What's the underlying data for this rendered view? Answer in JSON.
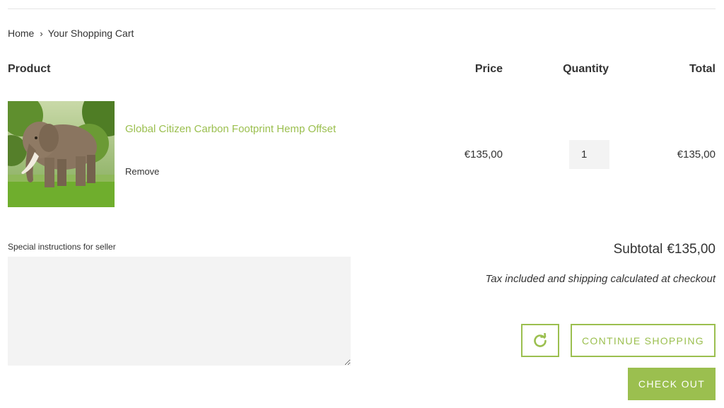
{
  "breadcrumb": {
    "home": "Home",
    "separator": "›",
    "current": "Your Shopping Cart"
  },
  "table_headers": {
    "product": "Product",
    "price": "Price",
    "quantity": "Quantity",
    "total": "Total"
  },
  "cart_items": [
    {
      "title": "Global Citizen Carbon Footprint Hemp Offset",
      "image": "elephant-photo",
      "remove_label": "Remove",
      "price": "€135,00",
      "quantity": "1",
      "total": "€135,00"
    }
  ],
  "notes": {
    "label": "Special instructions for seller",
    "value": ""
  },
  "summary": {
    "subtotal_label": "Subtotal",
    "subtotal_value": "€135,00",
    "tax_note": "Tax included and shipping calculated at checkout"
  },
  "actions": {
    "update_icon": "refresh-icon",
    "continue_label": "CONTINUE SHOPPING",
    "checkout_label": "CHECK OUT"
  },
  "colors": {
    "accent": "#9bbf4f",
    "text": "#333333",
    "input_bg": "#f3f3f3"
  }
}
